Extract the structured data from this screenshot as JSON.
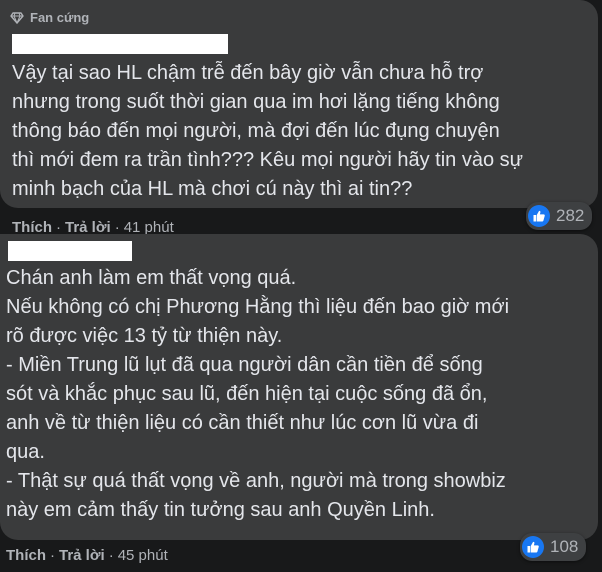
{
  "comments": [
    {
      "badge": "Fan cứng",
      "text": "Vậy tại sao HL chậm trễ đến bây giờ vẫn chưa hỗ trợ\nnhưng trong suốt thời gian qua im hơi lặng tiếng không\nthông báo đến mọi người, mà đợi đến lúc đụng chuyện\nthì mới đem ra trần tình??? Kêu mọi người hãy tin vào sự\nminh bạch của HL mà chơi cú này thì ai tin??",
      "like_action": "Thích",
      "reply_action": "Trả lời",
      "separator": "·",
      "time": "41 phút",
      "reaction_count": "282"
    },
    {
      "text": "Chán anh làm em thất vọng quá.\nNếu không có chị Phương Hằng thì liệu đến bao giờ mới\nrõ được việc 13 tỷ từ thiện này.\n- Miền Trung lũ lụt đã qua người dân cần tiền để sống\nsót và khắc phục sau lũ, đến hiện tại cuộc sống đã ổn,\nanh về từ thiện liệu có cần thiết như lúc cơn lũ vừa đi\nqua.\n- Thật sự quá thất vọng về anh, người mà trong showbiz\nnày em cảm thấy tin tưởng sau anh Quyền Linh.",
      "like_action": "Thích",
      "reply_action": "Trả lời",
      "separator": "·",
      "time": "45 phút",
      "reaction_count": "108"
    }
  ],
  "icons": {
    "badge": "diamond-icon",
    "reaction": "like-icon"
  },
  "colors": {
    "background": "#18191a",
    "bubble": "#3a3b3c",
    "text": "#e4e6eb",
    "secondary_text": "#b0b3b8",
    "like_blue": "#1877f2"
  }
}
